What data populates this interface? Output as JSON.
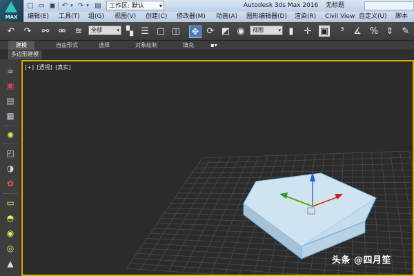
{
  "app": {
    "title": "Autodesk 3ds Max 2016",
    "document_title": "无标题",
    "logo_text": "MAX"
  },
  "quick_access": {
    "workspace_label": "工作区: 默认",
    "icons": [
      "new-file-icon",
      "open-file-icon",
      "save-file-icon",
      "undo-icon",
      "undo-dropdown-icon",
      "redo-icon",
      "redo-dropdown-icon",
      "project-folder-icon"
    ]
  },
  "menu": {
    "items": [
      "编辑(E)",
      "工具(T)",
      "组(G)",
      "视图(V)",
      "创建(C)",
      "修改器(M)",
      "动画(A)",
      "图形编辑器(D)",
      "渲染(R)",
      "Civil View",
      "自定义(U)",
      "脚本(S)"
    ]
  },
  "toolbar": {
    "selection_filter": "全部",
    "coord_system": "视图"
  },
  "ribbon": {
    "tabs": [
      "建模",
      "自由形式",
      "选择",
      "对象绘制",
      "填充"
    ],
    "active_tab": "建模",
    "subtab": "多边形建模"
  },
  "viewport": {
    "labels": [
      "[+]",
      "[透视]",
      "[真实]"
    ],
    "border_color": "#d9b300",
    "background": "#2b2b2b"
  },
  "watermark": {
    "text": "头条 @四月笙"
  }
}
